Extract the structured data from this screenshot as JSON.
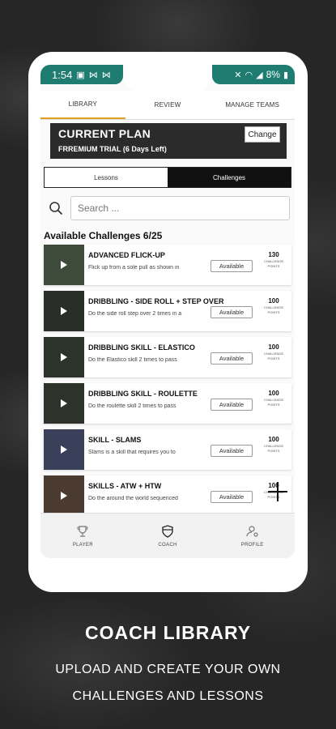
{
  "status_bar": {
    "time": "1:54",
    "battery": "8%"
  },
  "tabs": [
    {
      "label": "LIBRARY",
      "active": true
    },
    {
      "label": "REVIEW",
      "active": false
    },
    {
      "label": "MANAGE TEAMS",
      "active": false
    }
  ],
  "plan": {
    "title": "CURRENT PLAN",
    "subtitle": "FRREMIUM TRIAL (6 Days Left)",
    "change_label": "Change"
  },
  "toggle": {
    "lessons": "Lessons",
    "challenges": "Challenges",
    "selected": "challenges"
  },
  "search": {
    "placeholder": "Search ..."
  },
  "list_header": "Available Challenges 6/25",
  "challenges": [
    {
      "title": "ADVANCED FLICK-UP",
      "desc": "Flick up from a sole pull as shown in",
      "status": "Available",
      "points": "130",
      "points_label_1": "CHALLENGE",
      "points_label_2": "POINTS",
      "thumb_color": "#3e4a3a"
    },
    {
      "title": "DRIBBLING - SIDE ROLL + STEP OVER",
      "desc": "Do the side roll step over 2 times in a",
      "status": "Available",
      "points": "100",
      "points_label_1": "CHALLENGE",
      "points_label_2": "POINTS",
      "thumb_color": "#2a2e28"
    },
    {
      "title": "DRIBBLING SKILL - ELASTICO",
      "desc": "Do the Elastico skill 2 times to pass",
      "status": "Available",
      "points": "100",
      "points_label_1": "CHALLENGE",
      "points_label_2": "POINTS",
      "thumb_color": "#2c332b"
    },
    {
      "title": "DRIBBLING SKILL - ROULETTE",
      "desc": "Do the roulette skill 2 times to pass",
      "status": "Available",
      "points": "100",
      "points_label_1": "CHALLENGE",
      "points_label_2": "POINTS",
      "thumb_color": "#2d322a"
    },
    {
      "title": "SKILL - SLAMS",
      "desc": "Slams is a skill that requires you to",
      "status": "Available",
      "points": "100",
      "points_label_1": "CHALLENGE",
      "points_label_2": "POINTS",
      "thumb_color": "#3a3f5a"
    },
    {
      "title": "SKILLS - ATW + HTW",
      "desc": "Do the around the world sequenced",
      "status": "Available",
      "points": "100",
      "points_label_1": "CHALLENGE",
      "points_label_2": "POINTS",
      "thumb_color": "#4a3a30"
    }
  ],
  "bottom_nav": [
    {
      "label": "PLAYER",
      "icon": "trophy-icon"
    },
    {
      "label": "COACH",
      "icon": "shield-icon"
    },
    {
      "label": "PROFILE",
      "icon": "profile-gear-icon"
    }
  ],
  "caption": {
    "title": "COACH LIBRARY",
    "line1": "UPLOAD AND CREATE YOUR OWN",
    "line2": "CHALLENGES AND LESSONS"
  },
  "colors": {
    "status_bar": "#1e7d70",
    "active_tab_underline": "#e0a020",
    "plan_bg": "#2b2b2b"
  }
}
